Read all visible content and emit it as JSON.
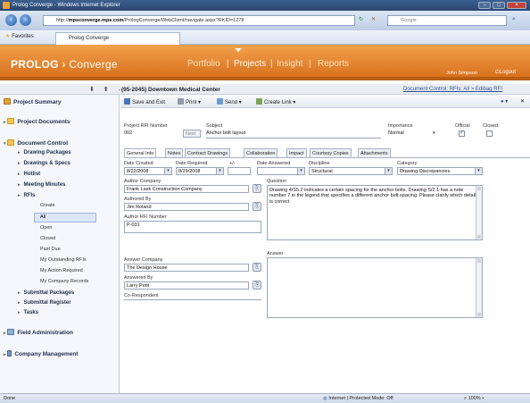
{
  "window": {
    "title": "Prolog Converge - Windows Internet Explorer",
    "url_prefix": "http://",
    "url_host": "mpsconverge.mps.com",
    "url_path": "/PrologConverge/WebClient/navigate.aspx?RKID=1278",
    "search_placeholder": "Google",
    "favorites_label": "Favorites",
    "tab_label": "Prolog Converge"
  },
  "app": {
    "logo_main": "PROLOG",
    "logo_sep": "›",
    "logo_sub": "Converge",
    "nav": [
      {
        "label": "Portfolio"
      },
      {
        "label": "|"
      },
      {
        "label": "Projects"
      },
      {
        "label": "|"
      },
      {
        "label": "Insight"
      },
      {
        "label": "|"
      },
      {
        "label": "Reports"
      }
    ],
    "username": "John Simpson",
    "logout": "Logout"
  },
  "context": {
    "arrows": "⬇ ⬆ ←",
    "title": "(95-2045) Downtown Medical Center",
    "breadcrumb": "Document Control: RFIs: All > Edibag RFI"
  },
  "sidebar": {
    "summary": "Project Summary",
    "documents": "Project Documents",
    "doc_control": "Document Control",
    "sub": [
      "Drawing Packages",
      "Drawings & Specs",
      "Hotlist",
      "Meeting Minutes",
      "RFIs"
    ],
    "leaves": [
      "Create",
      "All",
      "Open",
      "Closed",
      "Past Due",
      "My Outstanding RFIs",
      "My Action Required",
      "My Company Records"
    ],
    "sub2": [
      "Submittal Packages",
      "Submittal Register",
      "Tasks"
    ],
    "field_admin": "Field Administration",
    "company_mgmt": "Company Management"
  },
  "toolbar": {
    "save_exit": "Save and Exit",
    "print": "Print",
    "send": "Send",
    "create_link": "Create Link"
  },
  "form": {
    "rfi_number_label": "Project RFI Number",
    "rfi_number": "002",
    "next_btn": "Next",
    "subject_label": "Subject",
    "subject": "Anchor bolt layout",
    "importance_label": "Importance",
    "importance": "Normal",
    "official_label": "Official",
    "closed_label": "Closed",
    "tabs": [
      "General Info",
      "Notes",
      "Contract Drawings",
      "Collaboration",
      "Impact",
      "Courtesy Copies",
      "Attachments"
    ],
    "date_created_label": "Date Created",
    "date_created": "8/22/2008",
    "date_required_label": "Date Required",
    "date_required": "8/29/2008",
    "plusminus_label": "+/-",
    "date_answered_label": "Date Answered",
    "discipline_label": "Discipline",
    "discipline": "Structural",
    "category_label": "Category",
    "category": "Drawing Discrepancies",
    "author_company_label": "Author Company",
    "author_company": "Frank Lask Construction Company",
    "authored_by_label": "Authored By",
    "authored_by": "Jim Roland",
    "author_rfi_label": "Author RFI Number",
    "author_rfi": "P-031",
    "question_label": "Question",
    "question": "Drawing 4/S5.2 indicates a certain spacing for the anchor bolts. Drawing S/2.1 has a note number 7 in the legend that specifies a different anchor bolt spacing.  Please clarify which detail is correct",
    "answer_company_label": "Answer Company",
    "answer_company": "The Design House",
    "answered_by_label": "Answered By",
    "answered_by": "Larry Petit",
    "corespondent_label": "Co-Respondent",
    "answer_label": "Answer"
  },
  "status": {
    "left": "Done",
    "mid": "Internet | Protected Mode: Off",
    "zoom": "100%"
  }
}
